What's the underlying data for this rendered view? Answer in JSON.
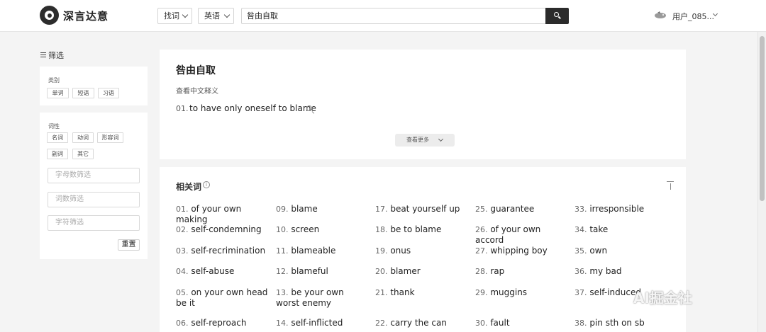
{
  "header": {
    "brand": "深言达意",
    "mode_select": "找词",
    "language_select": "英语",
    "search_value": "咎由自取",
    "username": "用户_085..."
  },
  "sidebar": {
    "title": "筛选",
    "category_label": "类别",
    "categories": [
      "单词",
      "短语",
      "习语"
    ],
    "pos_label": "词性",
    "pos": [
      "名词",
      "动词",
      "形容词",
      "副词",
      "其它"
    ],
    "letter_filter_placeholder": "字母数筛选",
    "word_count_placeholder": "词数筛选",
    "char_filter_placeholder": "字符筛选",
    "reset_label": "重置"
  },
  "entry": {
    "title": "咎由自取",
    "see_chinese": "查看中文释义",
    "definitions": [
      {
        "num": "01.",
        "text": "to have only oneself to blame"
      }
    ],
    "more_label": "查看更多"
  },
  "related": {
    "title": "相关词",
    "columns": [
      [
        {
          "n": "01.",
          "w": "of your own making"
        },
        {
          "n": "02.",
          "w": "self-condemning"
        },
        {
          "n": "03.",
          "w": "self-recrimination"
        },
        {
          "n": "04.",
          "w": "self-abuse"
        },
        {
          "n": "05.",
          "w": "on your own head be it"
        },
        {
          "n": "06.",
          "w": "self-reproach"
        }
      ],
      [
        {
          "n": "09.",
          "w": "blame"
        },
        {
          "n": "10.",
          "w": "screen"
        },
        {
          "n": "11.",
          "w": "blameable"
        },
        {
          "n": "12.",
          "w": "blameful"
        },
        {
          "n": "13.",
          "w": "be your own worst enemy"
        },
        {
          "n": "14.",
          "w": "self-inflicted"
        }
      ],
      [
        {
          "n": "17.",
          "w": "beat yourself up"
        },
        {
          "n": "18.",
          "w": "be to blame"
        },
        {
          "n": "19.",
          "w": "onus"
        },
        {
          "n": "20.",
          "w": "blamer"
        },
        {
          "n": "21.",
          "w": "thank"
        },
        {
          "n": "22.",
          "w": "carry the can"
        }
      ],
      [
        {
          "n": "25.",
          "w": "guarantee"
        },
        {
          "n": "26.",
          "w": "of your own accord"
        },
        {
          "n": "27.",
          "w": "whipping boy"
        },
        {
          "n": "28.",
          "w": "rap"
        },
        {
          "n": "29.",
          "w": "muggins"
        },
        {
          "n": "30.",
          "w": "fault"
        }
      ],
      [
        {
          "n": "33.",
          "w": "irresponsible"
        },
        {
          "n": "34.",
          "w": "take"
        },
        {
          "n": "35.",
          "w": "own"
        },
        {
          "n": "36.",
          "w": "my bad"
        },
        {
          "n": "37.",
          "w": "self-induced"
        },
        {
          "n": "38.",
          "w": "pin sth on sb"
        }
      ]
    ]
  },
  "watermark": "AI掘金社"
}
